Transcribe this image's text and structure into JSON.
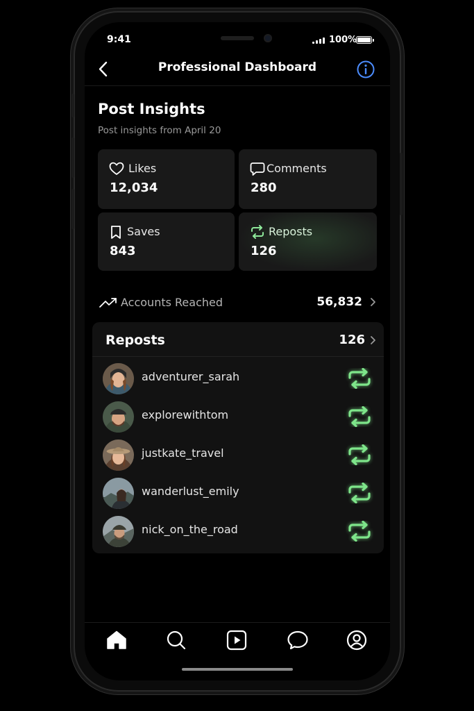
{
  "status_bar": {
    "time": "9:41",
    "battery": "100%"
  },
  "nav": {
    "title": "Professional Dashboard",
    "back_icon": "chevron-left-icon",
    "info_icon": "info-icon"
  },
  "insights": {
    "title": "Post Insights",
    "subtitle": "Post insights from April 20",
    "stats": [
      {
        "label": "Likes",
        "value": "12,034",
        "icon": "heart-icon"
      },
      {
        "label": "Comments",
        "value": "280",
        "icon": "comment-icon"
      },
      {
        "label": "Saves",
        "value": "843",
        "icon": "bookmark-icon"
      },
      {
        "label": "Reposts",
        "value": "126",
        "icon": "repost-icon",
        "accent": "#8ee89a"
      }
    ]
  },
  "reach": {
    "label": "Accounts Reached",
    "value": "56,832"
  },
  "reposts": {
    "title": "Reposts",
    "count": "126",
    "users": [
      {
        "username": "adventurer_sarah"
      },
      {
        "username": "explorewithtom"
      },
      {
        "username": "justkate_travel"
      },
      {
        "username": "wanderlust_emily"
      },
      {
        "username": "nick_on_the_road"
      }
    ]
  },
  "tabbar": {
    "items": [
      "home-icon",
      "search-icon",
      "reels-icon",
      "messages-icon",
      "profile-icon"
    ],
    "active": "home-icon"
  },
  "colors": {
    "accent_green": "#7ee58a",
    "info_blue": "#4c8dff",
    "card_bg": "#191919"
  }
}
